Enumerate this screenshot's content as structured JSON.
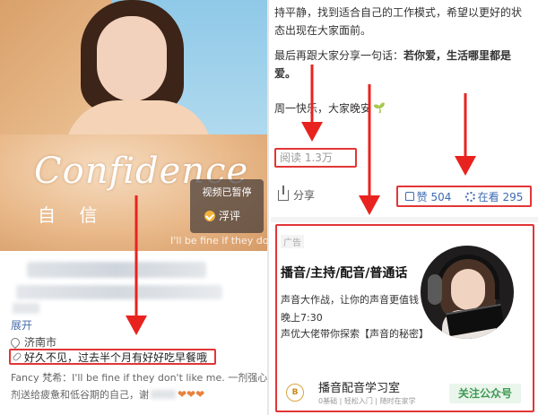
{
  "left": {
    "video": {
      "overlay_title": "Confidence",
      "overlay_subtitle": "自 信",
      "paused_label": "视频已暂停",
      "float_label": "浮评",
      "caption": "I'll be fine if they don't l"
    },
    "expand_label": "展开",
    "location": "济南市",
    "post_title": "好久不见，过去半个月有好好吃早餐哦",
    "lyric_line1": "Fancy 梵希：I'll be fine if they don't like me. 一剂强心",
    "lyric_line2_start": "剂送给疲惫和低谷期的自己，谢",
    "hearts": "❤❤❤"
  },
  "right": {
    "paragraph1": "持平静，找到适合自己的工作模式，希望以更好的状态出现在大家面前。",
    "paragraph2_start": "最后再跟大家分享一句话：",
    "paragraph2_bold": "若你爱，生活哪里都是爱。",
    "paragraph3": "周一快乐，大家晚安",
    "reads": "阅读 1.3万",
    "share_label": "分享",
    "like_label": "赞 504",
    "watching_label": "在看 295",
    "ad": {
      "tag": "广告",
      "title": "播音/主持/配音/普通话",
      "lines": [
        "声音大作战，让你的声音更值钱",
        "晚上7:30",
        "声优大佬带你探索【声音的秘密】"
      ],
      "account_name": "播音配音学习室",
      "account_meta": "0基础 | 轻松入门 | 随时在家学",
      "follow_label": "关注公众号",
      "logo_text": "B"
    }
  },
  "colors": {
    "annotation_red": "#e8231f",
    "link_blue": "#3d6bb3",
    "follow_green": "#3e9a52"
  }
}
